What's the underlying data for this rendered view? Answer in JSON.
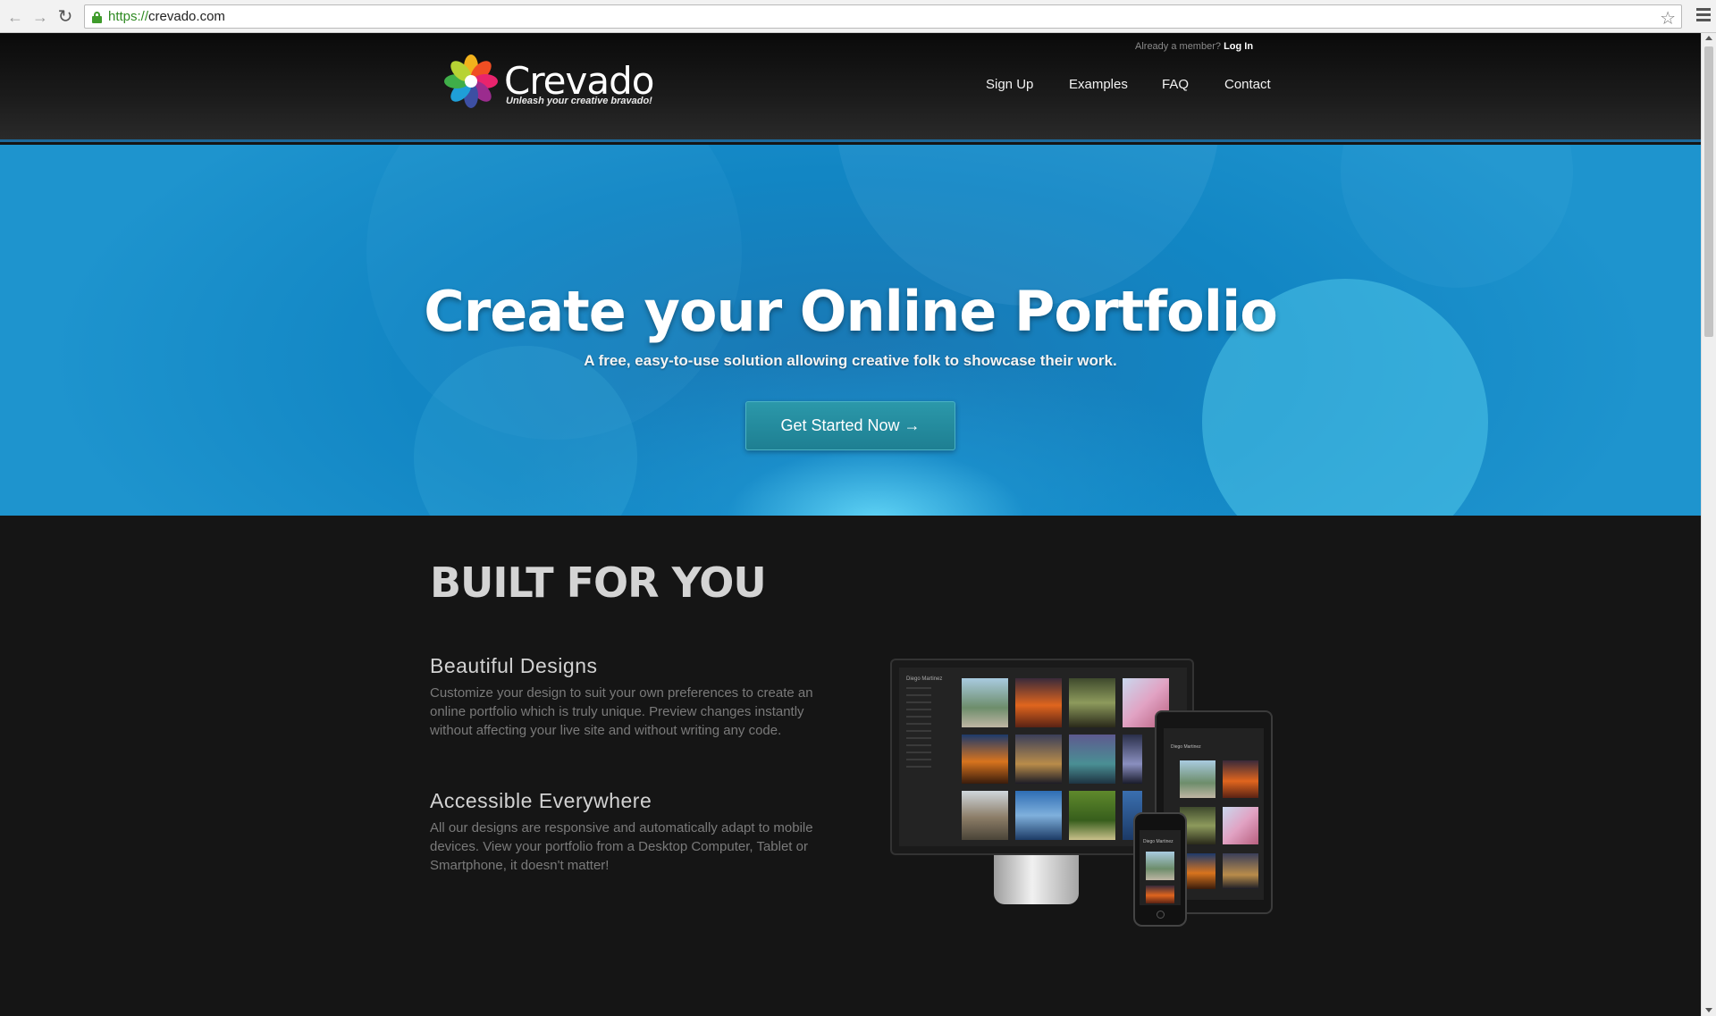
{
  "browser": {
    "url_scheme": "https://",
    "url_host": "crevado.com",
    "back_icon": "arrow-left",
    "forward_icon": "arrow-right",
    "reload_icon": "reload",
    "star_icon": "star-outline",
    "menu_icon": "hamburger"
  },
  "header": {
    "logo_name": "Crevado",
    "logo_tagline": "Unleash your creative bravado!",
    "member_prompt": "Already a member?",
    "login_label": "Log In",
    "nav": [
      "Sign Up",
      "Examples",
      "FAQ",
      "Contact"
    ]
  },
  "hero": {
    "title": "Create your Online Portfolio",
    "subtitle": "A free, easy-to-use solution allowing creative folk to showcase their work.",
    "cta_label": "Get Started Now →"
  },
  "features": {
    "heading": "BUILT FOR YOU",
    "items": [
      {
        "title": "Beautiful Designs",
        "text": "Customize your design to suit your own preferences to create an online portfolio which is truly unique. Preview changes instantly without affecting your live site and without writing any code."
      },
      {
        "title": "Accessible Everywhere",
        "text": "All our designs are responsive and automatically adapt to mobile devices. View your portfolio from a Desktop Computer, Tablet or Smartphone, it doesn't matter!"
      }
    ],
    "device_portfolio_name": "Diego Martinez"
  },
  "colors": {
    "hero_blue": "#1286c4",
    "cta_teal": "#2b98aa",
    "header_border": "#1d6a9c"
  }
}
